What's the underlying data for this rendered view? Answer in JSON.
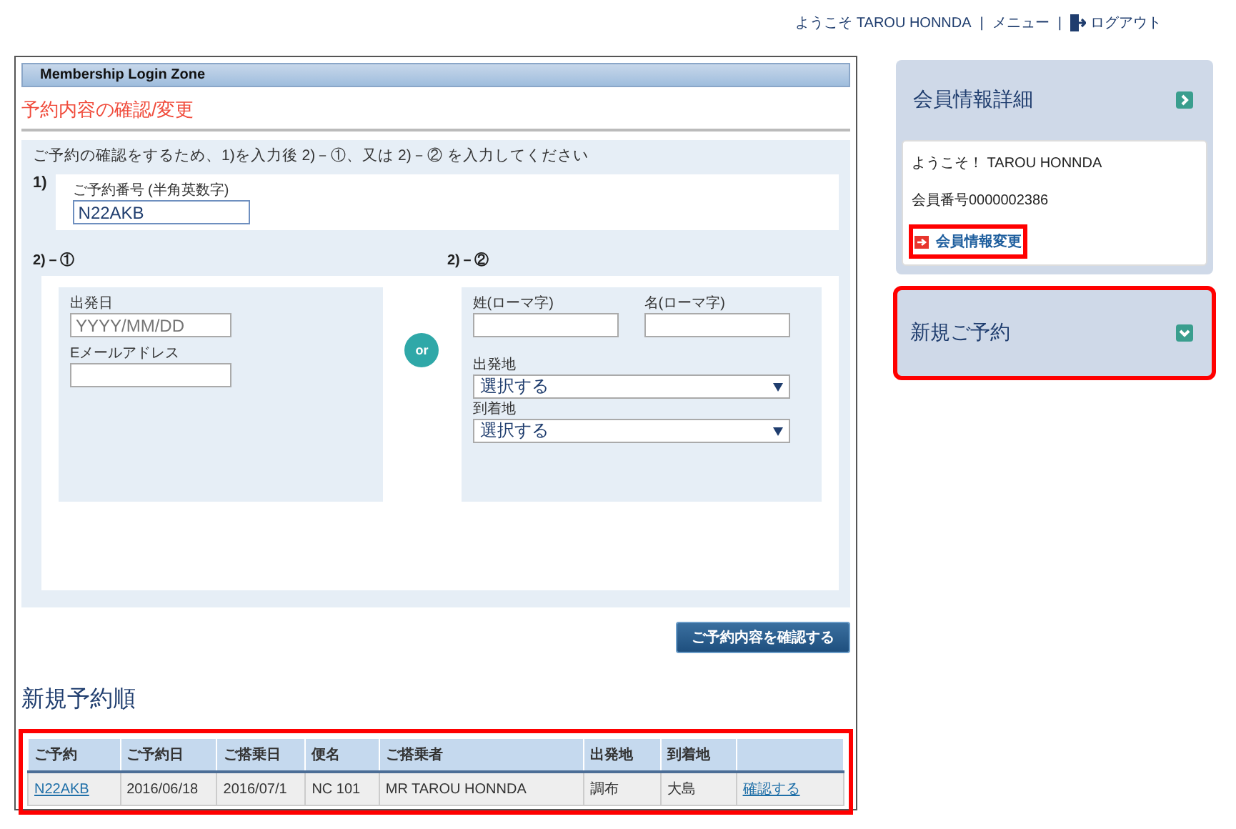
{
  "header": {
    "welcome": "ようこそ TAROU HONNDA",
    "separator_1": "|",
    "menu": "メニュー",
    "separator_2": "|",
    "logout": "ログアウト"
  },
  "main": {
    "zone_title": "Membership Login Zone",
    "page_title": "予約内容の確認/変更",
    "instruction": "ご予約の確認をするため、1)を入力後 2)－①、又は 2)－② を入力してください",
    "step1": {
      "number": "1)",
      "label": "ご予約番号 (半角英数字)",
      "value": "N22AKB"
    },
    "step2a": {
      "heading": "2)－①",
      "date_label": "出発日",
      "date_placeholder": "YYYY/MM/DD",
      "email_label": "Eメールアドレス"
    },
    "or_badge": "or",
    "step2b": {
      "heading": "2)－②",
      "last_name_label": "姓(ローマ字)",
      "first_name_label": "名(ローマ字)",
      "origin_label": "出発地",
      "origin_value": "選択する",
      "destination_label": "到着地",
      "destination_value": "選択する"
    },
    "confirm_button": "ご予約内容を確認する"
  },
  "bookings": {
    "title": "新規予約順",
    "highlighted": true,
    "columns": [
      "ご予約",
      "ご予約日",
      "ご搭乗日",
      "便名",
      "ご搭乗者",
      "出発地",
      "到着地",
      ""
    ],
    "rows": [
      {
        "cells": [
          "N22AKB",
          "2016/06/18",
          "2016/07/1",
          "NC 101",
          "MR  TAROU  HONNDA",
          "調布",
          "大島",
          "確認する"
        ]
      }
    ]
  },
  "sidebar": {
    "member_panel": {
      "title": "会員情報詳細",
      "greeting": "ようこそ！  TAROU HONNDA",
      "member_number": "会員番号0000002386",
      "change_link": "会員情報変更",
      "change_link_highlighted": true
    },
    "new_booking_panel": {
      "title": "新規ご予約",
      "highlighted": true
    }
  }
}
